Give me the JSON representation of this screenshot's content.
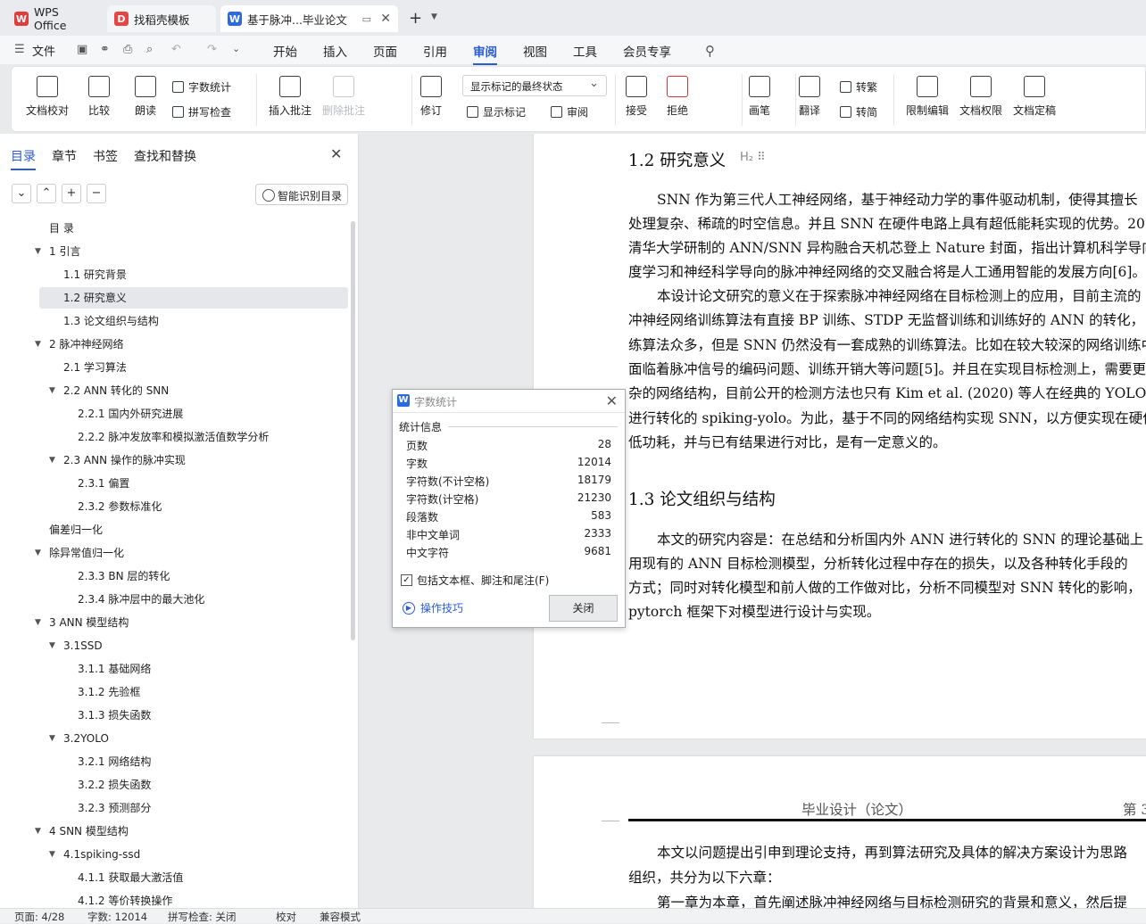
{
  "tabs": [
    {
      "label": "WPS Office",
      "icon": "wps-logo-icon"
    },
    {
      "label": "找稻壳模板",
      "icon": "docer-icon"
    },
    {
      "label": "基于脉冲...毕业论文",
      "icon": "word-doc-icon"
    }
  ],
  "menubar": {
    "file_label": "文件",
    "items": [
      "开始",
      "插入",
      "页面",
      "引用",
      "审阅",
      "视图",
      "工具",
      "会员专享"
    ],
    "active": "审阅"
  },
  "ribbon": {
    "doc_check": "文档校对",
    "compare": "比较",
    "read_aloud": "朗读",
    "word_count": "字数统计",
    "spell_check": "拼写检查",
    "insert_comment": "插入批注",
    "delete_comment": "删除批注",
    "track": "修订",
    "markup_state": "显示标记的最终状态",
    "show_markup": "显示标记",
    "review_pane": "审阅",
    "accept": "接受",
    "reject": "拒绝",
    "ink": "画笔",
    "translate": "翻译",
    "to_traditional": "转繁",
    "to_simplified": "转简",
    "restrict_edit": "限制编辑",
    "doc_permission": "文档权限",
    "doc_finalize": "文档定稿"
  },
  "nav": {
    "tabs": [
      "目录",
      "章节",
      "书签",
      "查找和替换"
    ],
    "smart_toc": "智能识别目录",
    "buttons": [
      "⌄",
      "⌃",
      "+",
      "−"
    ]
  },
  "toc": [
    {
      "text": "目 录",
      "level": 0
    },
    {
      "text": "1 引言",
      "level": 0,
      "caret": true
    },
    {
      "text": "1.1 研究背景",
      "level": 1
    },
    {
      "text": "1.2 研究意义",
      "level": 1,
      "selected": true
    },
    {
      "text": "1.3 论文组织与结构",
      "level": 1
    },
    {
      "text": "2 脉冲神经网络",
      "level": 0,
      "caret": true
    },
    {
      "text": "2.1 学习算法",
      "level": 1
    },
    {
      "text": "2.2 ANN 转化的 SNN",
      "level": 1,
      "caret": true
    },
    {
      "text": "2.2.1 国内外研究进展",
      "level": 2
    },
    {
      "text": "2.2.2 脉冲发放率和模拟激活值数学分析",
      "level": 2
    },
    {
      "text": "2.3 ANN 操作的脉冲实现",
      "level": 1,
      "caret": true
    },
    {
      "text": "2.3.1 偏置",
      "level": 2
    },
    {
      "text": "2.3.2 参数标准化",
      "level": 2
    },
    {
      "text": "偏差归一化",
      "level": 0
    },
    {
      "text": "除异常值归一化",
      "level": 0,
      "caret": true
    },
    {
      "text": "2.3.3 BN 层的转化",
      "level": 2
    },
    {
      "text": "2.3.4 脉冲层中的最大池化",
      "level": 2
    },
    {
      "text": "3 ANN 模型结构",
      "level": 0,
      "caret": true
    },
    {
      "text": "3.1SSD",
      "level": 1,
      "caret": true
    },
    {
      "text": "3.1.1 基础网络",
      "level": 2
    },
    {
      "text": "3.1.2 先验框",
      "level": 2
    },
    {
      "text": "3.1.3 损失函数",
      "level": 2
    },
    {
      "text": "3.2YOLO",
      "level": 1,
      "caret": true
    },
    {
      "text": "3.2.1 网络结构",
      "level": 2
    },
    {
      "text": "3.2.2 损失函数",
      "level": 2
    },
    {
      "text": "3.2.3    预测部分",
      "level": 2
    },
    {
      "text": "4 SNN 模型结构",
      "level": 0,
      "caret": true
    },
    {
      "text": "4.1spiking-ssd",
      "level": 1,
      "caret": true
    },
    {
      "text": "4.1.1 获取最大激活值",
      "level": 2
    },
    {
      "text": "4.1.2 等价转换操作",
      "level": 2
    }
  ],
  "document": {
    "h_marker": "H₂ ⠿",
    "heading_1_2": "1.2   研究意义",
    "para1": [
      "SNN 作为第三代人工神经网络，基于神经动力学的事件驱动机制，使得其擅长",
      "处理复杂、稀疏的时空信息。并且 SNN 在硬件电路上具有超低能耗实现的优势。20",
      "清华大学研制的 ANN/SNN 异构融合天机芯登上 Nature 封面，指出计算机科学导向",
      "度学习和神经科学导向的脉冲神经网络的交叉融合将是人工通用智能的发展方向[6]。"
    ],
    "para2": [
      "本设计论文研究的意义在于探索脉冲神经网络在目标检测上的应用，目前主流的",
      "冲神经网络训练算法有直接 BP 训练、STDP 无监督训练和训练好的 ANN 的转化，",
      "练算法众多，但是 SNN 仍然没有一套成熟的训练算法。比如在较大较深的网络训练中",
      "面临着脉冲信号的编码问题、训练开销大等问题[5]。并且在实现目标检测上，需要更",
      "杂的网络结构，目前公开的检测方法也只有 Kim et al. (2020) 等人在经典的 YOLO 模",
      "进行转化的 spiking-yolo。为此，基于不同的网络结构实现 SNN，以方便实现在硬件",
      "低功耗，并与已有结果进行对比，是有一定意义的。"
    ],
    "heading_1_3": "1.3   论文组织与结构",
    "para3": [
      "本文的研究内容是：在总结和分析国内外 ANN 进行转化的 SNN 的理论基础上",
      "用现有的 ANN 目标检测模型，分析转化过程中存在的损失，以及各种转化手段的",
      "方式；同时对转化模型和前人做的工作做对比，分析不同模型对 SNN 转化的影响，",
      "pytorch 框架下对模型进行设计与实现。"
    ],
    "header_text": "毕业设计（论文）",
    "header_right": "第 3",
    "para4": [
      "本文以问题提出引申到理论支持，再到算法研究及具体的解决方案设计为思路",
      "组织，共分为以下六章：",
      "第一章为本章，首先阐述脉冲神经网络与目标检测研究的背景和意义，然后提"
    ]
  },
  "dialog": {
    "title": "字数统计",
    "section": "统计信息",
    "stats": [
      {
        "label": "页数",
        "value": "28"
      },
      {
        "label": "字数",
        "value": "12014"
      },
      {
        "label": "字符数(不计空格)",
        "value": "18179"
      },
      {
        "label": "字符数(计空格)",
        "value": "21230"
      },
      {
        "label": "段落数",
        "value": "583"
      },
      {
        "label": "非中文单词",
        "value": "2333"
      },
      {
        "label": "中文字符",
        "value": "9681"
      }
    ],
    "checkbox_label": "包括文本框、脚注和尾注(F)",
    "checkbox_checked": true,
    "tips": "操作技巧",
    "close": "关闭"
  },
  "status": {
    "page": "页面: 4/28",
    "words": "字数: 12014",
    "spell": "拼写检查: 关闭",
    "proof": "校对",
    "compat": "兼容模式"
  },
  "colors": {
    "accent": "#2a5bd7",
    "wps_red": "#e23b3b",
    "word_blue": "#2c6ae5"
  }
}
